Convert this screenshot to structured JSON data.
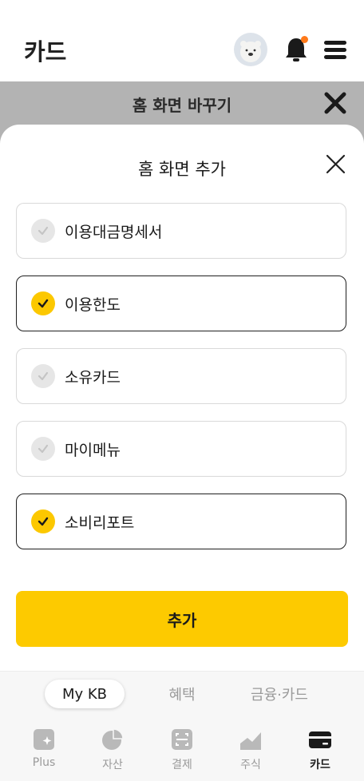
{
  "header": {
    "title": "카드"
  },
  "edit_bar": {
    "title": "홈 화면 바꾸기"
  },
  "sheet": {
    "title": "홈 화면 추가",
    "options": [
      {
        "label": "이용대금명세서",
        "selected": false
      },
      {
        "label": "이용한도",
        "selected": true
      },
      {
        "label": "소유카드",
        "selected": false
      },
      {
        "label": "마이메뉴",
        "selected": false
      },
      {
        "label": "소비리포트",
        "selected": true
      }
    ],
    "add_label": "추가"
  },
  "segments": {
    "items": [
      "My KB",
      "혜택",
      "금융·카드"
    ],
    "active": "My KB"
  },
  "tabs": {
    "items": [
      {
        "label": "Plus",
        "icon": "plus-star-icon"
      },
      {
        "label": "자산",
        "icon": "pie-chart-icon"
      },
      {
        "label": "결제",
        "icon": "scan-icon"
      },
      {
        "label": "주식",
        "icon": "stock-chart-icon"
      },
      {
        "label": "카드",
        "icon": "card-icon"
      }
    ],
    "active": "카드"
  },
  "colors": {
    "accent": "#fdca00",
    "notification_dot": "#ff7a1a"
  }
}
